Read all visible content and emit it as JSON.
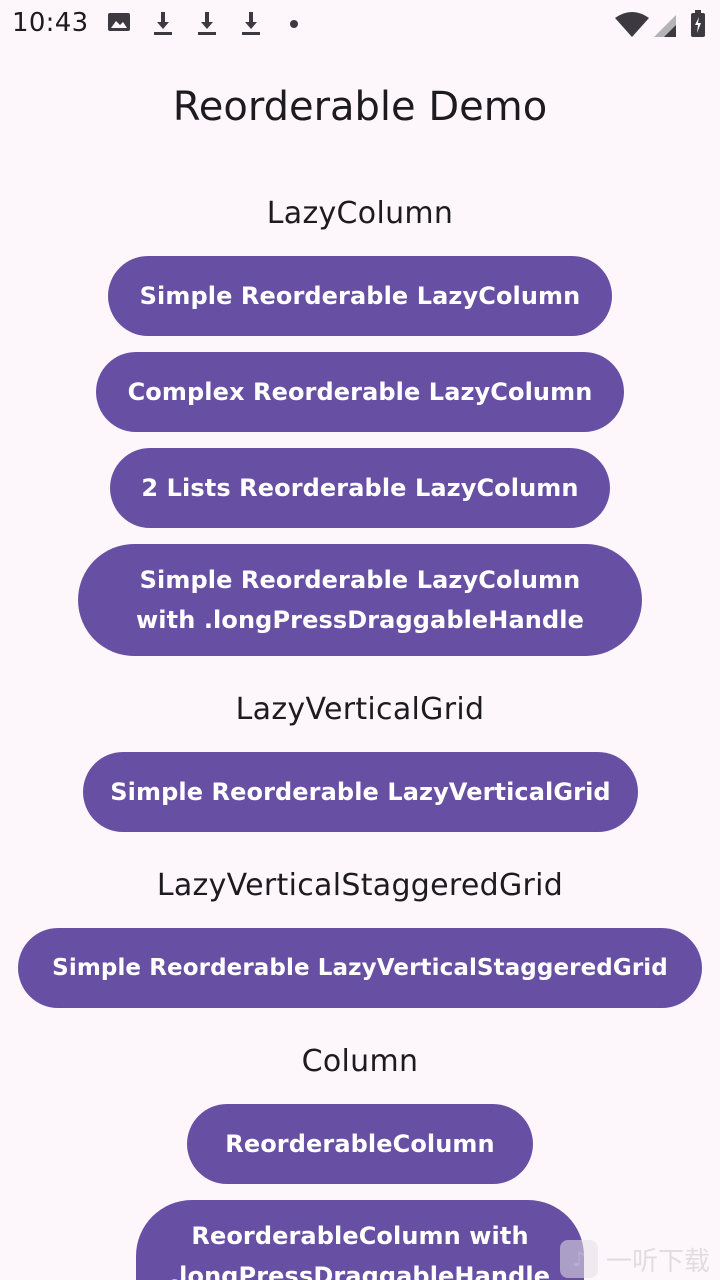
{
  "status_bar": {
    "time": "10:43",
    "icons_left": [
      "image-icon",
      "download-icon",
      "download-icon",
      "download-icon",
      "dot-icon"
    ],
    "icons_right": [
      "wifi-icon",
      "signal-icon",
      "battery-icon"
    ]
  },
  "page": {
    "title": "Reorderable Demo"
  },
  "sections": [
    {
      "title": "LazyColumn",
      "buttons": [
        {
          "label": "Simple Reorderable LazyColumn"
        },
        {
          "label": "Complex Reorderable LazyColumn"
        },
        {
          "label": "2 Lists Reorderable LazyColumn"
        },
        {
          "label": "Simple Reorderable LazyColumn with .longPressDraggableHandle"
        }
      ]
    },
    {
      "title": "LazyVerticalGrid",
      "buttons": [
        {
          "label": "Simple Reorderable LazyVerticalGrid"
        }
      ]
    },
    {
      "title": "LazyVerticalStaggeredGrid",
      "buttons": [
        {
          "label": "Simple Reorderable LazyVerticalStaggeredGrid"
        }
      ]
    },
    {
      "title": "Column",
      "buttons": [
        {
          "label": "ReorderableColumn"
        },
        {
          "label": "ReorderableColumn with .longPressDraggableHandle"
        }
      ]
    }
  ],
  "watermark": {
    "text": "一听下载"
  },
  "colors": {
    "background": "#fdf7fc",
    "button": "#6750a4",
    "button_text": "#ffffff",
    "text": "#1d1b20"
  }
}
